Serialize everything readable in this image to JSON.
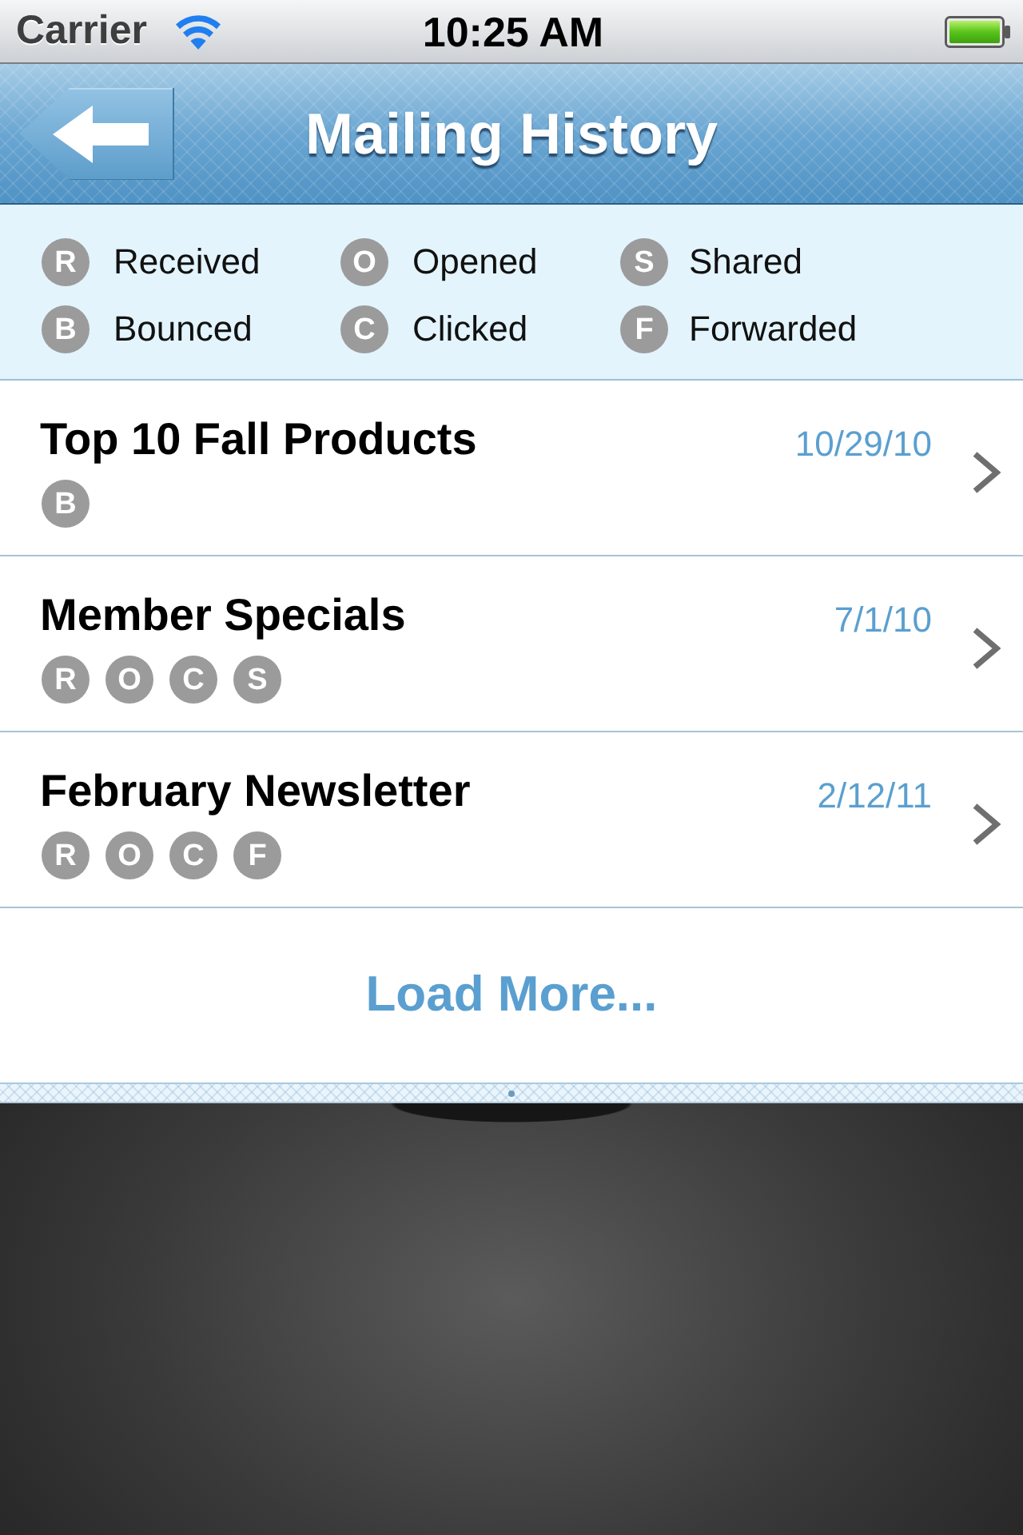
{
  "status_bar": {
    "carrier": "Carrier",
    "time": "10:25 AM"
  },
  "nav_bar": {
    "title": "Mailing History"
  },
  "legend": [
    {
      "code": "R",
      "label": "Received"
    },
    {
      "code": "O",
      "label": "Opened"
    },
    {
      "code": "S",
      "label": "Shared"
    },
    {
      "code": "B",
      "label": "Bounced"
    },
    {
      "code": "C",
      "label": "Clicked"
    },
    {
      "code": "F",
      "label": "Forwarded"
    }
  ],
  "mailings": [
    {
      "title": "Top 10 Fall Products",
      "date": "10/29/10",
      "statuses": [
        "B"
      ]
    },
    {
      "title": "Member Specials",
      "date": "7/1/10",
      "statuses": [
        "R",
        "O",
        "C",
        "S"
      ]
    },
    {
      "title": "February Newsletter",
      "date": "2/12/11",
      "statuses": [
        "R",
        "O",
        "C",
        "F"
      ]
    }
  ],
  "load_more": {
    "label": "Load More..."
  }
}
